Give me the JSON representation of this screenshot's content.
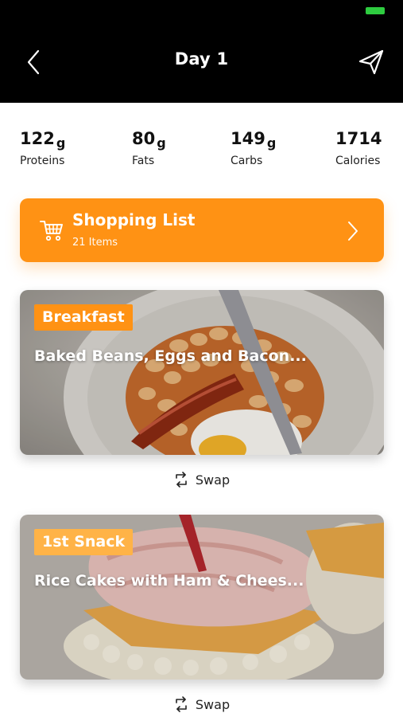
{
  "header": {
    "title": "Day 1",
    "back_icon": "chevron-left-icon",
    "send_icon": "paper-plane-icon",
    "battery_color": "#2ecc40"
  },
  "macros": [
    {
      "value": "122",
      "unit": "g",
      "label": "Proteins"
    },
    {
      "value": "80",
      "unit": "g",
      "label": "Fats"
    },
    {
      "value": "149",
      "unit": "g",
      "label": "Carbs"
    },
    {
      "value": "1714",
      "unit": "",
      "label": "Calories"
    }
  ],
  "shopping": {
    "title": "Shopping List",
    "subtitle": "21 Items",
    "icon": "shopping-cart-icon",
    "color": "#ff9214"
  },
  "meals": [
    {
      "tag": "Breakfast",
      "name": "Baked Beans, Eggs and Bacon...",
      "tag_color": "#ff9214",
      "swap_label": "Swap"
    },
    {
      "tag": "1st Snack",
      "name": "Rice Cakes with Ham & Chees...",
      "tag_color": "#ffb347",
      "swap_label": "Swap"
    }
  ]
}
